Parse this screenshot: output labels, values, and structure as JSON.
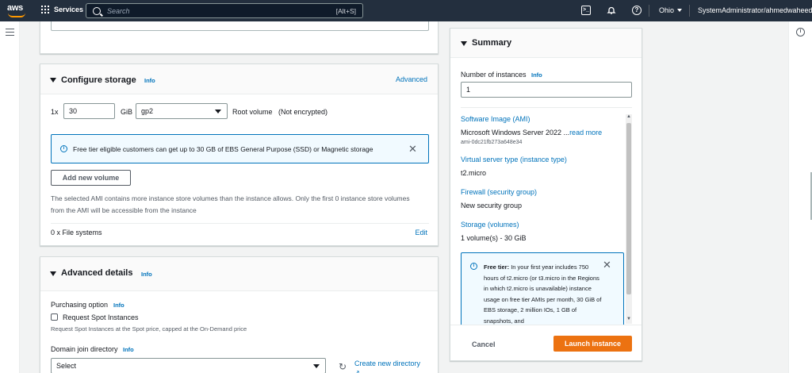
{
  "topnav": {
    "logo": "aws",
    "services": "Services",
    "search_placeholder": "Search",
    "search_shortcut": "[Alt+S]",
    "region": "Ohio",
    "account": "SystemAdministrator/ahmedwaheed"
  },
  "storage": {
    "title": "Configure storage",
    "info": "Info",
    "advanced": "Advanced",
    "multiplier": "1x",
    "size": "30",
    "unit": "GiB",
    "volume_type": "gp2",
    "root_label": "Root volume",
    "encryption": "(Not encrypted)",
    "free_tier_notice": "Free tier eligible customers can get up to 30 GB of EBS General Purpose (SSD) or Magnetic storage",
    "add_volume": "Add new volume",
    "store_note": "The selected AMI contains more instance store volumes than the instance allows. Only the first 0 instance store volumes from the AMI will be accessible from the instance",
    "file_systems": "0 x File systems",
    "edit": "Edit"
  },
  "advanced": {
    "title": "Advanced details",
    "info": "Info",
    "purchasing_label": "Purchasing option",
    "purchasing_info": "Info",
    "spot_checkbox": "Request Spot Instances",
    "spot_help": "Request Spot Instances at the Spot price, capped at the On-Demand price",
    "domain_label": "Domain join directory",
    "domain_info": "Info",
    "domain_select": "Select",
    "create_directory": "Create new directory"
  },
  "summary": {
    "title": "Summary",
    "instances_label": "Number of instances",
    "instances_info": "Info",
    "instances_value": "1",
    "ami_heading": "Software Image (AMI)",
    "ami_name": "Microsoft Windows Server 2022 ...",
    "read_more": "read more",
    "ami_id": "ami-0dc21fb273a648e34",
    "type_heading": "Virtual server type (instance type)",
    "type_value": "t2.micro",
    "firewall_heading": "Firewall (security group)",
    "firewall_value": "New security group",
    "storage_heading": "Storage (volumes)",
    "storage_value": "1 volume(s) - 30 GiB",
    "free_tier_bold": "Free tier:",
    "free_tier_text": "In your first year includes 750 hours of t2.micro (or t3.micro in the Regions in which t2.micro is unavailable) instance usage on free tier AMIs per month, 30 GiB of EBS storage, 2 million IOs, 1 GB of snapshots, and",
    "cancel": "Cancel",
    "launch": "Launch instance"
  },
  "colors": {
    "nav_bg": "#232f3e",
    "link": "#0073bb",
    "primary": "#ec7211",
    "info_bg": "#f1faff",
    "info_border": "#0073bb"
  }
}
